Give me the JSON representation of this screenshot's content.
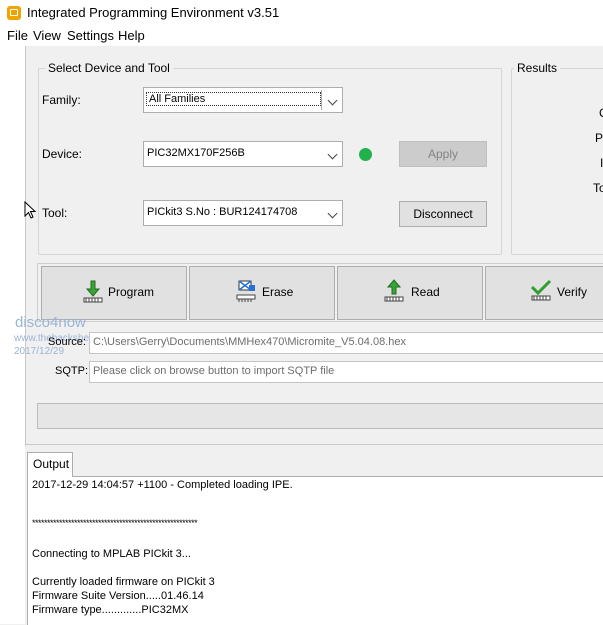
{
  "window": {
    "title": "Integrated Programming Environment v3.51"
  },
  "menu": [
    "File",
    "View",
    "Settings",
    "Help"
  ],
  "select_group": {
    "legend": "Select Device and Tool",
    "family_label": "Family:",
    "family_value": "All Families",
    "device_label": "Device:",
    "device_value": "PIC32MX170F256B",
    "apply_label": "Apply",
    "tool_label": "Tool:",
    "tool_value": "PICkit3 S.No : BUR124174708",
    "disconnect_label": "Disconnect",
    "status_color": "#22b14c"
  },
  "results": {
    "legend": "Results",
    "partial_labels": [
      "C",
      "Pa",
      "I",
      "To"
    ]
  },
  "actions": [
    "Program",
    "Erase",
    "Read",
    "Verify"
  ],
  "source": {
    "label": "Source:",
    "value": "C:\\Users\\Gerry\\Documents\\MMHex470\\Micromite_V5.04.08.hex"
  },
  "sqtp": {
    "label": "SQTP:",
    "placeholder": "Please click on browse button to import SQTP file"
  },
  "watermark": [
    "disco4now",
    "www.thebackshed.com",
    "2017/12/29"
  ],
  "output": {
    "tab": "Output",
    "lines": [
      "2017-12-29 14:04:57 +1100 - Completed loading IPE.",
      "",
      "",
      "*******************************************************",
      "",
      "Connecting to MPLAB PICkit 3...",
      "",
      "Currently loaded firmware on PICkit 3",
      "Firmware Suite Version.....01.46.14",
      "Firmware type.............PIC32MX"
    ]
  }
}
